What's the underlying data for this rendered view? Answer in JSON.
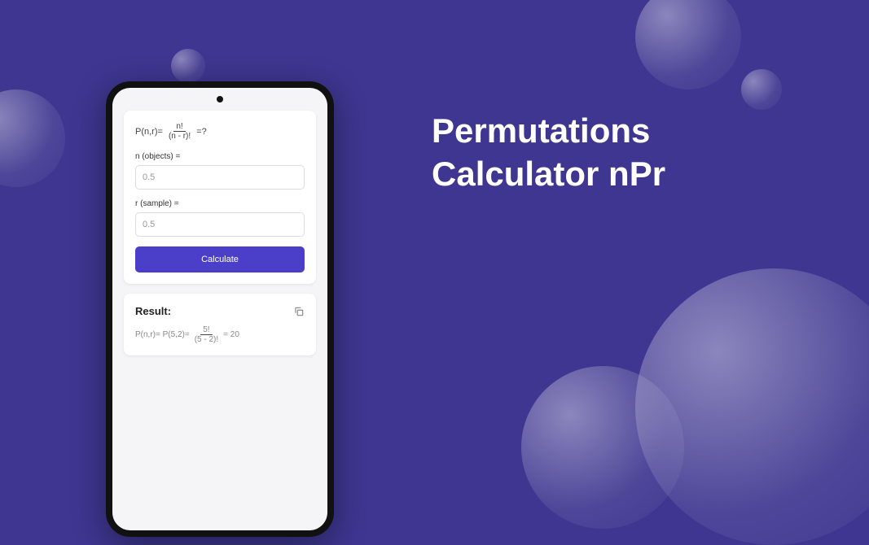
{
  "title_line1": "Permutations",
  "title_line2": "Calculator nPr",
  "formula": {
    "prefix": "P(n,r)=",
    "numerator": "n!",
    "denominator": "(n - r)!",
    "suffix": "=?"
  },
  "inputs": {
    "n_label": "n (objects) =",
    "n_value": "0.5",
    "r_label": "r (sample) =",
    "r_value": "0.5"
  },
  "calculate_button": "Calculate",
  "result": {
    "title": "Result:",
    "prefix": "P(n,r)= P(5,2)=",
    "numerator": "5!",
    "denominator": "(5 - 2)!",
    "value": "= 20"
  }
}
